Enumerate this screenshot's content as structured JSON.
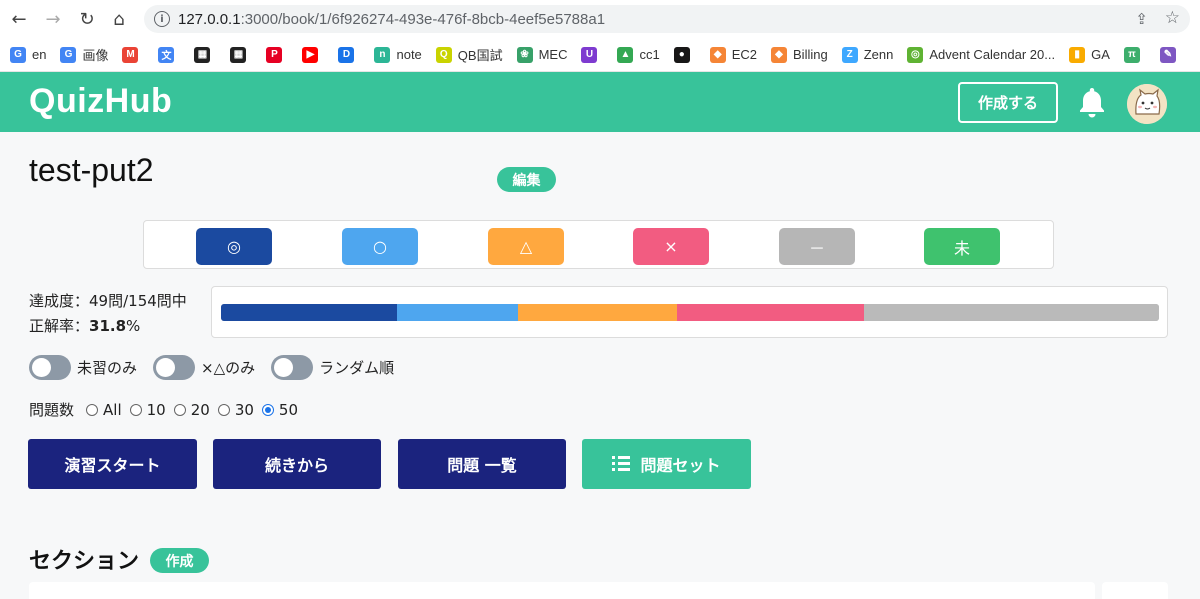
{
  "browser": {
    "url_host": "127.0.0.1",
    "url_rest": ":3000/book/1/6f926274-493e-476f-8bcb-4eef5e5788a1",
    "bookmarks": [
      {
        "label": "en",
        "color": "#4285f4",
        "glyph": "G"
      },
      {
        "label": "画像",
        "color": "#4285f4",
        "glyph": "G"
      },
      {
        "label": "",
        "color": "#ea4335",
        "glyph": "M"
      },
      {
        "label": "",
        "color": "#4285f4",
        "glyph": "文"
      },
      {
        "label": "",
        "color": "#222222",
        "glyph": "▦"
      },
      {
        "label": "",
        "color": "#222222",
        "glyph": "▦"
      },
      {
        "label": "",
        "color": "#e60023",
        "glyph": "P"
      },
      {
        "label": "",
        "color": "#ff0000",
        "glyph": "▶"
      },
      {
        "label": "",
        "color": "#1a73e8",
        "glyph": "D"
      },
      {
        "label": "note",
        "color": "#2cb696",
        "glyph": "n"
      },
      {
        "label": "QB国試",
        "color": "#c9d300",
        "glyph": "Q"
      },
      {
        "label": "MEC",
        "color": "#38a169",
        "glyph": "❀"
      },
      {
        "label": "",
        "color": "#7e3bd0",
        "glyph": "U"
      },
      {
        "label": "cc1",
        "color": "#34a853",
        "glyph": "▲"
      },
      {
        "label": "",
        "color": "#181717",
        "glyph": "●"
      },
      {
        "label": "EC2",
        "color": "#f58536",
        "glyph": "◆"
      },
      {
        "label": "Billing",
        "color": "#f58536",
        "glyph": "◆"
      },
      {
        "label": "Zenn",
        "color": "#3ea8ff",
        "glyph": "Z"
      },
      {
        "label": "Advent Calendar 20...",
        "color": "#5fb333",
        "glyph": "◎"
      },
      {
        "label": "GA",
        "color": "#f9ab00",
        "glyph": "▮"
      },
      {
        "label": "",
        "color": "#3dae6c",
        "glyph": "π"
      },
      {
        "label": "",
        "color": "#7e57c2",
        "glyph": "✎"
      }
    ]
  },
  "header": {
    "logo": "QuizHub",
    "create_label": "作成する",
    "brand_color": "#38c39a"
  },
  "book": {
    "title": "test-put2",
    "edit_label": "編集"
  },
  "status_buttons": [
    {
      "name": "double-circle",
      "glyph": "◎",
      "color": "#1b4aa0"
    },
    {
      "name": "circle",
      "glyph": "○",
      "color": "#4ea6ef"
    },
    {
      "name": "triangle",
      "glyph": "△",
      "color": "#ffa83f"
    },
    {
      "name": "cross",
      "glyph": "×",
      "color": "#f25c81"
    },
    {
      "name": "dash",
      "glyph": "－",
      "color": "#b6b6b6"
    },
    {
      "name": "unlearned",
      "glyph": "未",
      "color": "#3fc26e"
    }
  ],
  "progress": {
    "achievement_label": "達成度：",
    "achievement_value": "49問/154問中",
    "accuracy_label": "正解率：",
    "accuracy_value": "31.8",
    "accuracy_unit": "%",
    "segments": [
      {
        "name": "double-circle",
        "fraction": 0.188,
        "color": "#1b4aa0"
      },
      {
        "name": "circle",
        "fraction": 0.129,
        "color": "#4ea6ef"
      },
      {
        "name": "triangle",
        "fraction": 0.169,
        "color": "#ffa83f"
      },
      {
        "name": "cross",
        "fraction": 0.2,
        "color": "#f25c81"
      },
      {
        "name": "rest",
        "fraction": 0.314,
        "color": "#bababa"
      }
    ]
  },
  "toggles": [
    {
      "label": "未習のみ"
    },
    {
      "label": "×△のみ"
    },
    {
      "label": "ランダム順"
    }
  ],
  "question_count": {
    "label": "問題数",
    "options": [
      "All",
      "10",
      "20",
      "30",
      "50"
    ],
    "selected": "50"
  },
  "actions": {
    "start_label": "演習スタート",
    "continue_label": "続きから",
    "list_label": "問題 一覧",
    "set_label": "問題セット",
    "primary_color": "#1b237e",
    "secondary_color": "#38c39a"
  },
  "section": {
    "title": "セクション",
    "create_label": "作成"
  }
}
